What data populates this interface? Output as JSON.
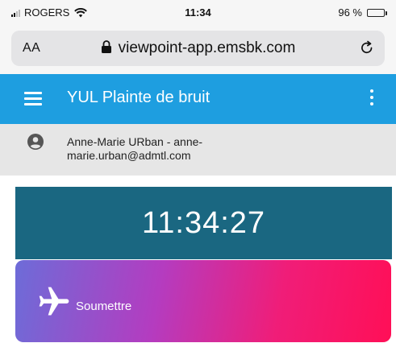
{
  "status_bar": {
    "carrier": "ROGERS",
    "time": "11:34",
    "battery": "96 %",
    "battery_level": 0.96
  },
  "browser": {
    "text_size_label": "AA",
    "url": "viewpoint-app.emsbk.com"
  },
  "app_bar": {
    "title": "YUL Plainte de bruit"
  },
  "user": {
    "text": "Anne-Marie URban - anne-marie.urban@admtl.com"
  },
  "clock": {
    "value": "11:34:27"
  },
  "submit": {
    "label": "Soumettre"
  },
  "colors": {
    "app_bar": "#1e9ee0",
    "clock_banner": "#1a6781",
    "user_row": "#e6e6e6",
    "gradient_start": "#6d6cd8",
    "gradient_end": "#ff0f57"
  },
  "icons": [
    "signal-icon",
    "wifi-icon",
    "battery-icon",
    "lock-icon",
    "reload-icon",
    "menu-icon",
    "more-vert-icon",
    "account-circle-icon",
    "airplane-icon"
  ]
}
